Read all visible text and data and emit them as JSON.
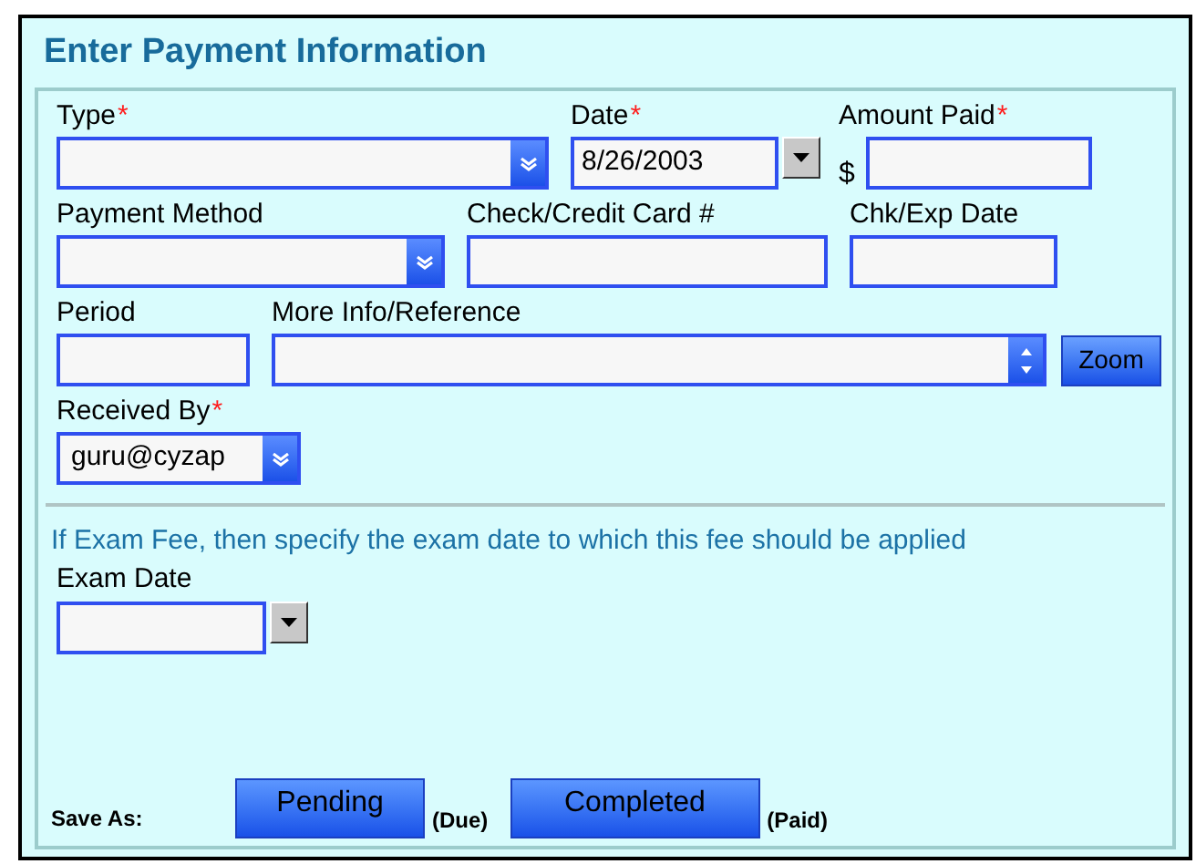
{
  "title": "Enter Payment Information",
  "rows": [
    {
      "fields": [
        {
          "kind": "select",
          "label": "Type",
          "required_mark": "*"
        },
        {
          "kind": "date",
          "label": "Date",
          "required_mark": "*",
          "value": "8/26/2003"
        },
        {
          "kind": "text",
          "label": "Amount Paid",
          "required_mark": "*",
          "prefix": "$"
        }
      ]
    },
    {
      "fields": [
        {
          "kind": "select",
          "label": "Payment Method"
        },
        {
          "kind": "text",
          "label": "Check/Credit Card #"
        },
        {
          "kind": "text",
          "label": "Chk/Exp Date"
        }
      ]
    },
    {
      "fields": [
        {
          "kind": "text",
          "label": "Period"
        },
        {
          "kind": "spin",
          "label": "More Info/Reference",
          "button": "Zoom"
        }
      ]
    },
    {
      "fields": [
        {
          "kind": "select",
          "label": "Received By",
          "required_mark": "*",
          "value": "guru@cyzap"
        }
      ]
    }
  ],
  "exam_note": "If Exam Fee, then specify the exam date to which this fee should be applied",
  "exam_field": {
    "kind": "date",
    "label": "Exam Date"
  },
  "save_as": {
    "label": "Save As:",
    "buttons": [
      {
        "label": "Pending",
        "note": "(Due)"
      },
      {
        "label": "Completed",
        "note": "(Paid)"
      }
    ]
  }
}
